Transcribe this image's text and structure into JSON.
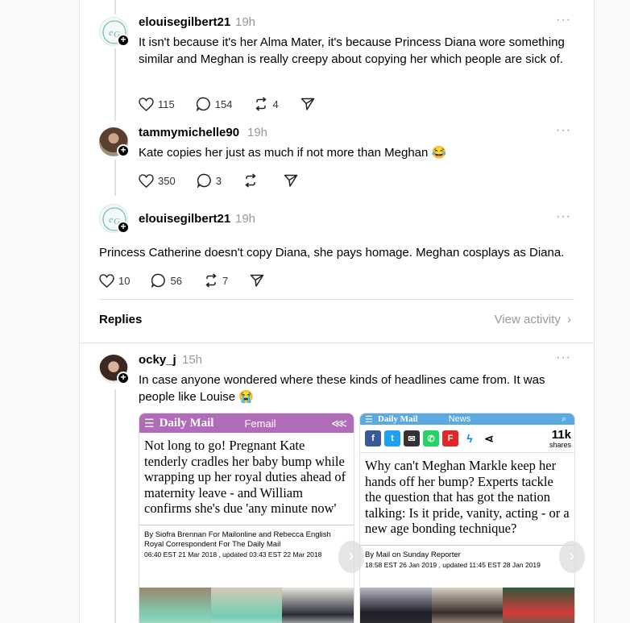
{
  "posts": [
    {
      "username": "elouisegilbert21",
      "time": "19h",
      "text": "It isn't because it's her Alma Mater, it's because Princess Diana wore something similar and Meghan is really creepy about copying her which people are sick of.",
      "likes": "115",
      "comments": "154",
      "reposts": "4",
      "avatar": "logo-avatar"
    },
    {
      "username": "tammymichelle90",
      "time": "19h",
      "text": "Kate copies her just as much if not more than Meghan 😂",
      "likes": "350",
      "comments": "3",
      "reposts": "",
      "avatar": "photo-avatar"
    },
    {
      "username": "elouisegilbert21",
      "time": "19h",
      "text": "Princess Catherine doesn't copy Diana, she pays homage. Meghan cosplays as Diana.",
      "likes": "10",
      "comments": "56",
      "reposts": "7",
      "avatar": "logo-avatar"
    }
  ],
  "replies_section": {
    "title": "Replies",
    "view_activity": "View activity"
  },
  "reply": {
    "username": "ocky_j",
    "time": "15h",
    "text": "In case anyone wondered where these kinds of headlines came from. It was people like Louise 😭"
  },
  "screenshot_left": {
    "header_brand": "Daily Mail",
    "header_section": "Femail",
    "header_color": "#b06cb8",
    "headline": "Not long to go! Pregnant Kate tenderly cradles her baby bump while wrapping up her royal duties ahead of maternity leave - and William confirms she's due 'any minute now'",
    "byline_1": "By Siofra Brennan For Mailonline and Rebecca English",
    "byline_2": "Royal Correspondent For The Daily Mail",
    "byline_3": "06:40 EST 21 Mar 2018 , updated 03:43 EST 22 Mar 2018"
  },
  "screenshot_right": {
    "header_brand": "Daily Mail",
    "header_section": "News",
    "header_color": "#5aa9e0",
    "shares_count": "11k",
    "shares_label": "shares",
    "headline": "Why can't Meghan Markle keep her hands off her bump? Experts tackle the question that has got the nation talking: Is it pride, vanity, acting - or a new age bonding technique?",
    "byline_1": "By Mail on Sunday Reporter",
    "byline_2": "18:58 EST 26 Jan 2019 , updated 11:45 EST 28 Jan 2019"
  },
  "colors": {
    "muted": "#999999",
    "divider": "#e3e3e3"
  }
}
